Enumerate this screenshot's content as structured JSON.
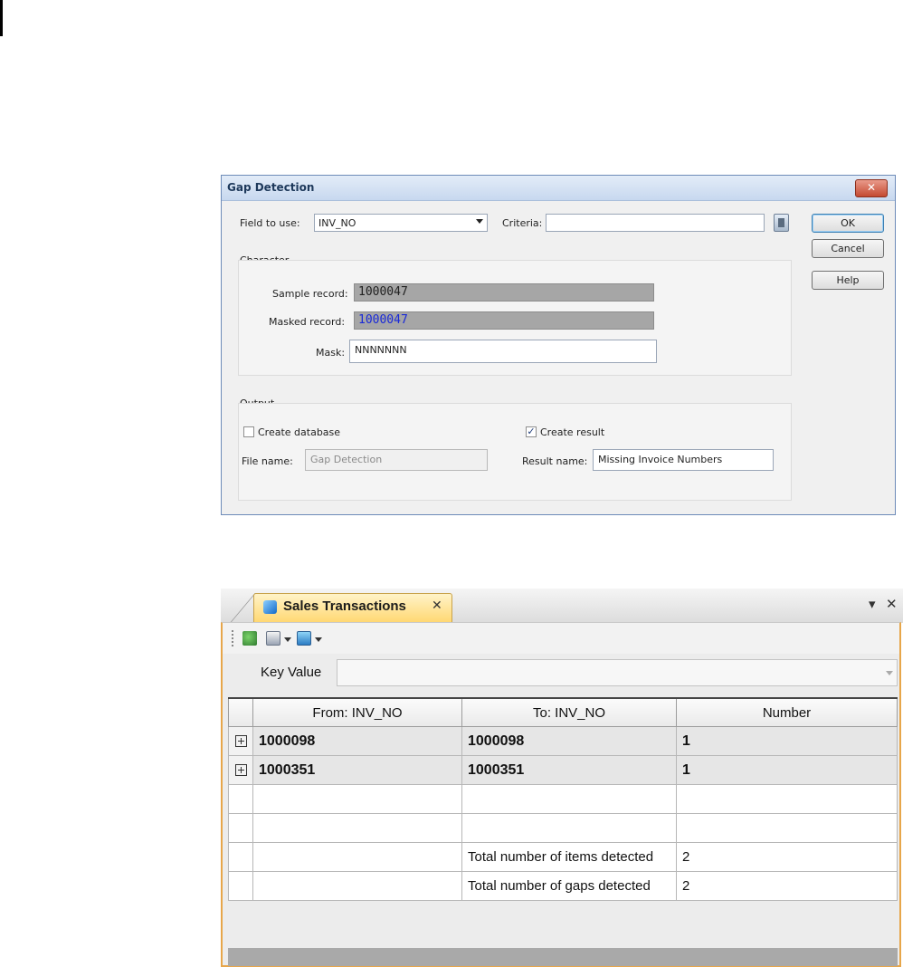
{
  "dialog": {
    "title": "Gap Detection",
    "close_glyph": "✕",
    "field_to_use_label": "Field to use:",
    "field_to_use_value": "INV_NO",
    "criteria_label": "Criteria:",
    "criteria_value": "",
    "buttons": {
      "ok": "OK",
      "cancel": "Cancel",
      "help": "Help"
    },
    "character": {
      "group_label": "Character",
      "sample_record_label": "Sample record:",
      "sample_record_value": "1000047",
      "masked_record_label": "Masked record:",
      "masked_record_value": "1000047",
      "mask_label": "Mask:",
      "mask_value": "NNNNNNN"
    },
    "output": {
      "group_label": "Output",
      "create_database_label": "Create database",
      "create_database_checked": false,
      "create_result_label": "Create result",
      "create_result_checked": true,
      "file_name_label": "File name:",
      "file_name_value": "Gap Detection",
      "result_name_label": "Result name:",
      "result_name_value": "Missing Invoice Numbers"
    }
  },
  "panel": {
    "tab_title": "Sales Transactions",
    "tab_close_glyph": "✕",
    "pin_glyph": "▾",
    "close_glyph": "✕",
    "toolbar_icons": [
      "export-icon",
      "print-icon",
      "query-icon"
    ],
    "key_value_label": "Key Value",
    "key_value_selected": "",
    "table": {
      "columns": [
        "From: INV_NO",
        "To: INV_NO",
        "Number"
      ],
      "rows": [
        {
          "from": "1000098",
          "to": "1000098",
          "number": "1"
        },
        {
          "from": "1000351",
          "to": "1000351",
          "number": "1"
        }
      ],
      "summary": [
        {
          "label": "Total number of items detected",
          "value": "2"
        },
        {
          "label": "Total number of gaps detected",
          "value": "2"
        }
      ]
    }
  }
}
